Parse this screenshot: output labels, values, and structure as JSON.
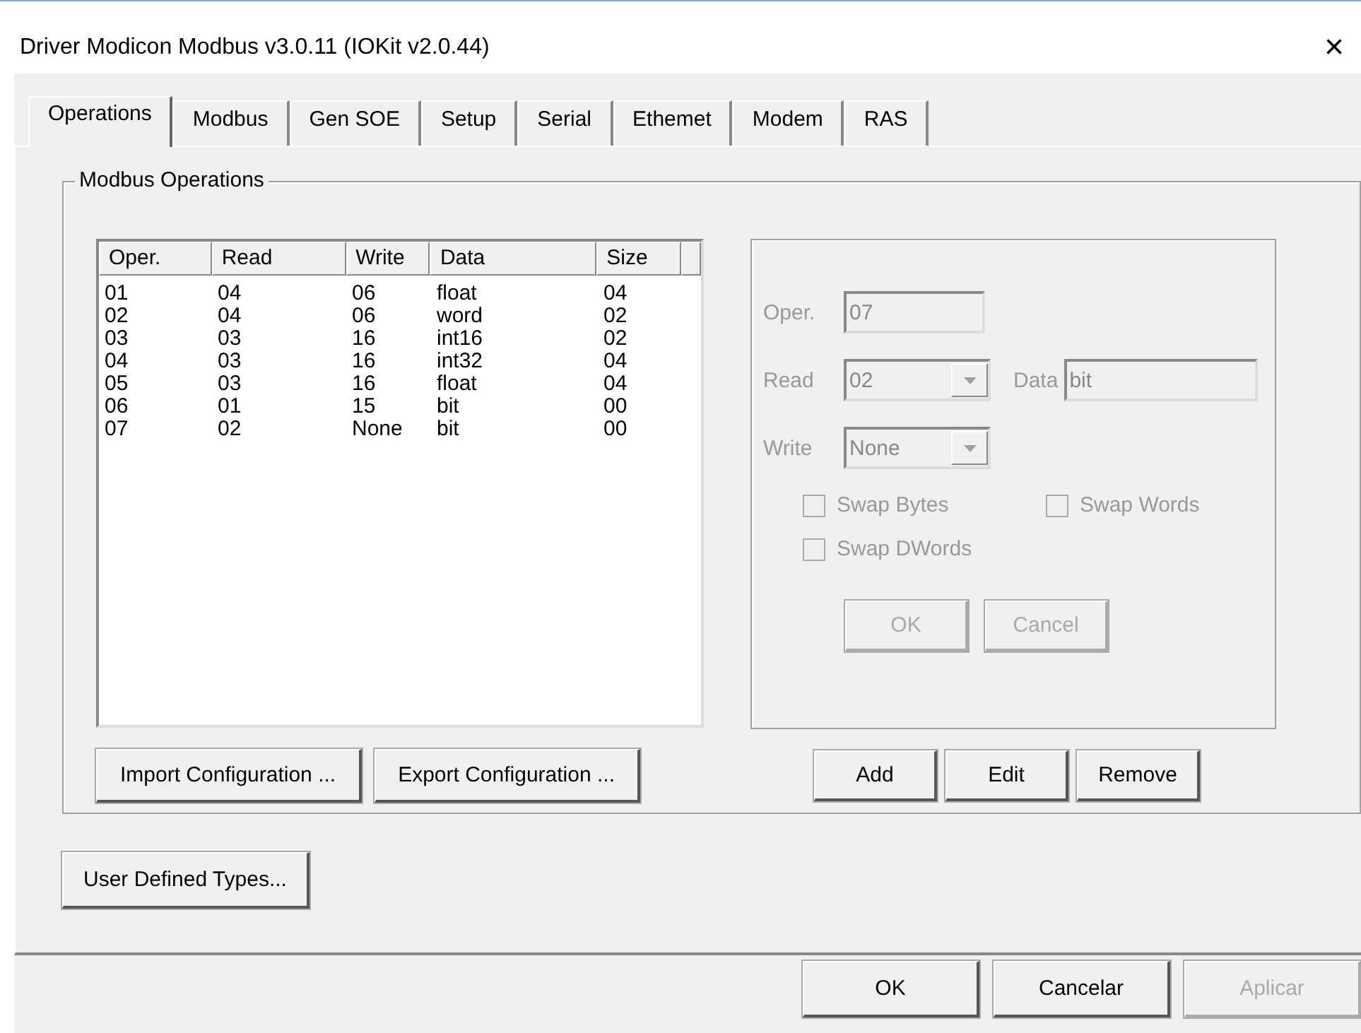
{
  "window": {
    "title": "Driver Modicon Modbus v3.0.11 (IOKit v2.0.44)",
    "close": "×"
  },
  "tabs": [
    {
      "label": "Operations",
      "selected": true
    },
    {
      "label": "Modbus",
      "selected": false
    },
    {
      "label": "Gen SOE",
      "selected": false
    },
    {
      "label": "Setup",
      "selected": false
    },
    {
      "label": "Serial",
      "selected": false
    },
    {
      "label": "Ethemet",
      "selected": false
    },
    {
      "label": "Modem",
      "selected": false
    },
    {
      "label": "RAS",
      "selected": false
    }
  ],
  "group": {
    "title": "Modbus Operations"
  },
  "list": {
    "columns": [
      "Oper.",
      "Read",
      "Write",
      "Data",
      "Size"
    ],
    "rows": [
      [
        "01",
        "04",
        "06",
        "float",
        "04"
      ],
      [
        "02",
        "04",
        "06",
        "word",
        "02"
      ],
      [
        "03",
        "03",
        "16",
        "int16",
        "02"
      ],
      [
        "04",
        "03",
        "16",
        "int32",
        "04"
      ],
      [
        "05",
        "03",
        "16",
        "float",
        "04"
      ],
      [
        "06",
        "01",
        "15",
        "bit",
        "00"
      ],
      [
        "07",
        "02",
        "None",
        "bit",
        "00"
      ]
    ]
  },
  "list_buttons": [
    "Import Configuration ...",
    "Export Configuration ..."
  ],
  "editor": {
    "disabled": true,
    "oper": {
      "label": "Oper.",
      "value": "07"
    },
    "read": {
      "label": "Read",
      "value": "02"
    },
    "data": {
      "label": "Data",
      "value": "bit"
    },
    "write": {
      "label": "Write",
      "value": "None"
    },
    "checkboxes": [
      {
        "label": "Swap Bytes",
        "checked": false
      },
      {
        "label": "Swap Words",
        "checked": false
      },
      {
        "label": "Swap DWords",
        "checked": false
      }
    ],
    "buttons": [
      "OK",
      "Cancel"
    ]
  },
  "op_buttons": [
    "Add",
    "Edit",
    "Remove"
  ],
  "user_types_button": "User Defined Types...",
  "dialog_buttons": [
    {
      "label": "OK",
      "disabled": false
    },
    {
      "label": "Cancelar",
      "disabled": false
    },
    {
      "label": "Aplicar",
      "disabled": true
    }
  ]
}
